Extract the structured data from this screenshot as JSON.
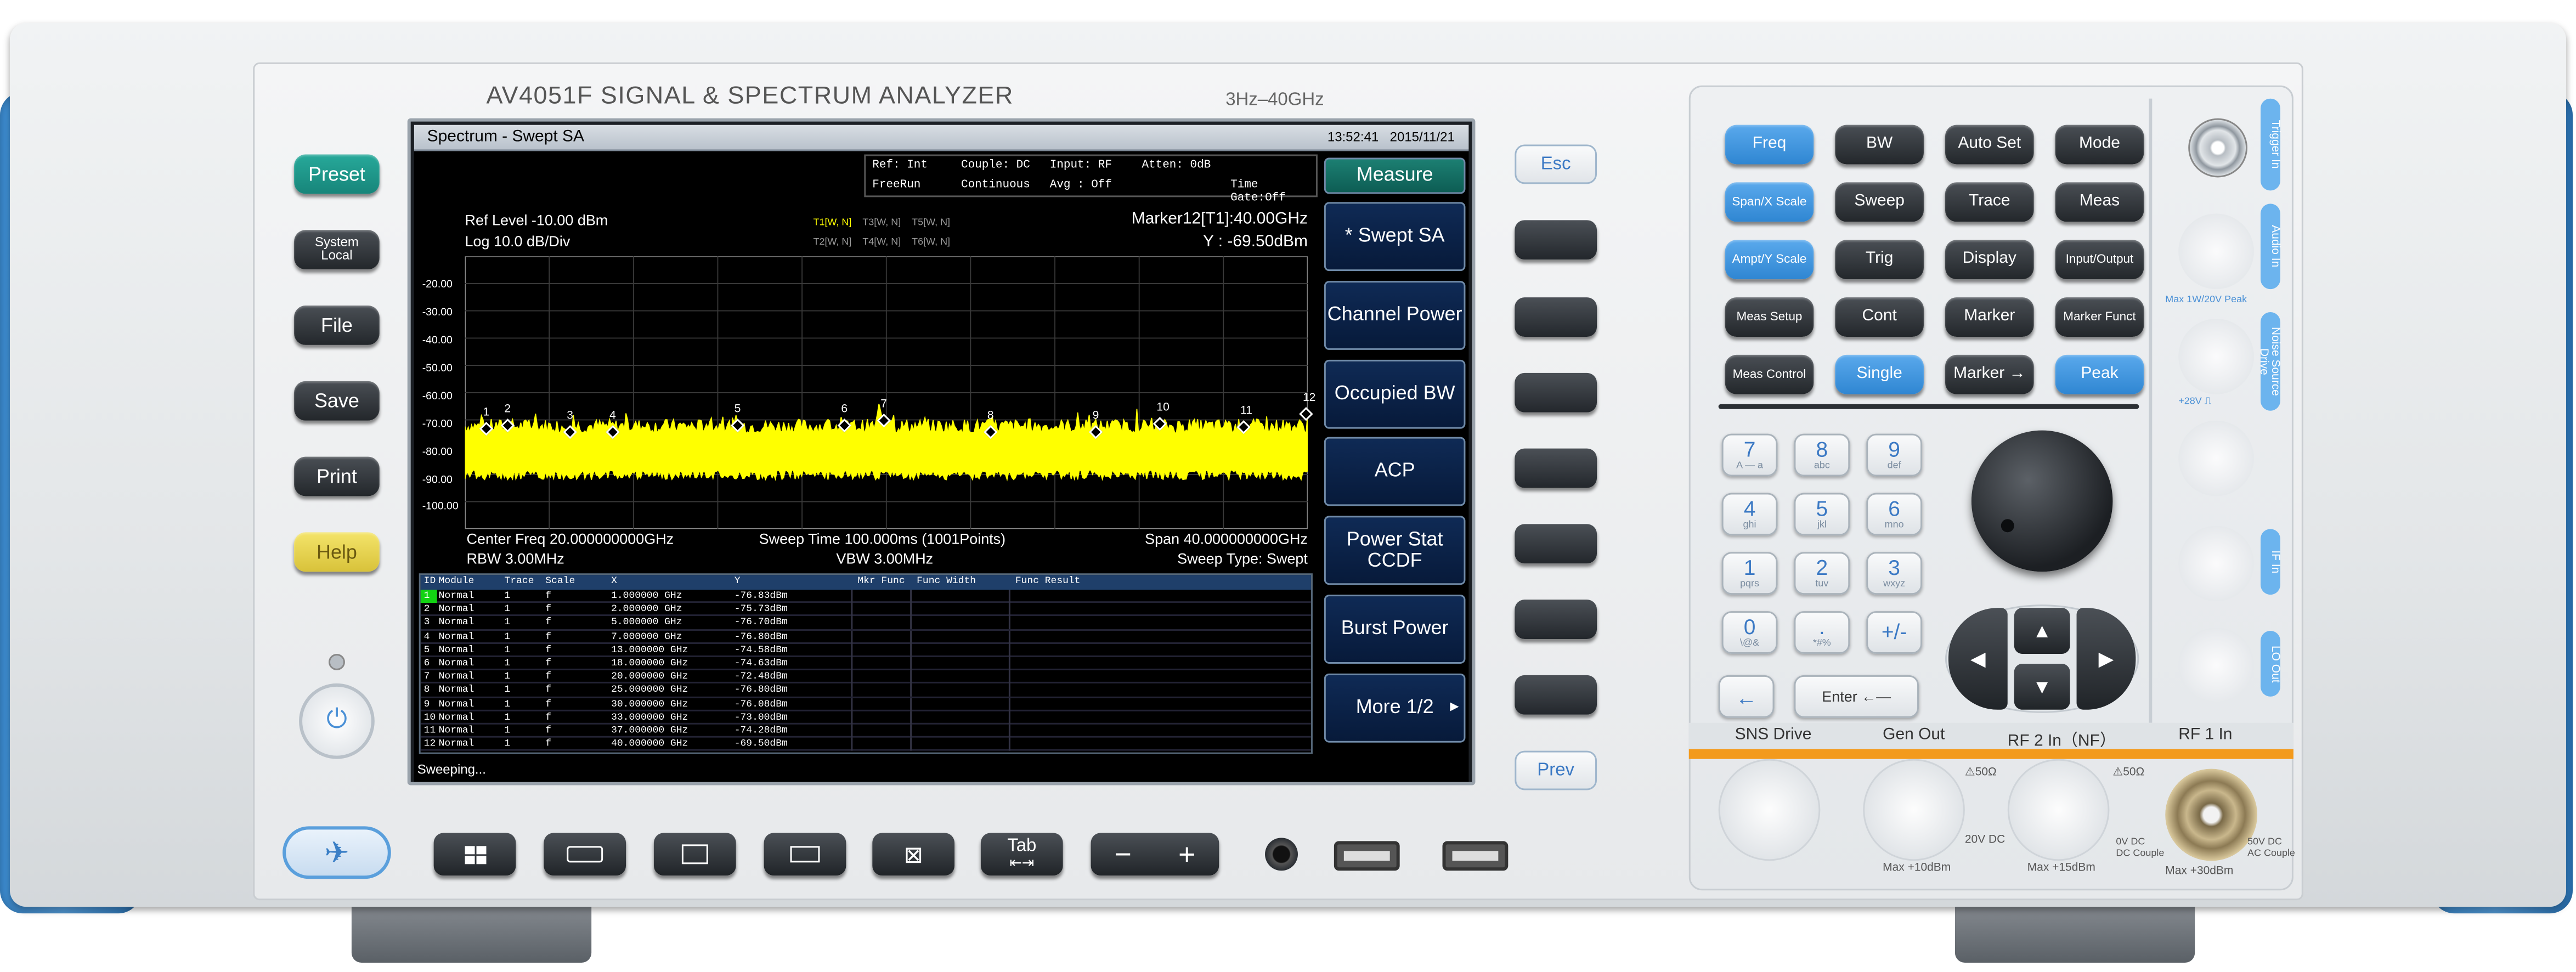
{
  "device": {
    "title": "AV4051F  SIGNAL & SPECTRUM ANALYZER",
    "freq_range": "3Hz–40GHz"
  },
  "left_keys": [
    "Preset",
    "System Local",
    "File",
    "Save",
    "Print",
    "Help"
  ],
  "screen": {
    "title": "Spectrum - Swept SA",
    "time": "13:52:41",
    "date": "2015/11/21",
    "status": {
      "ref": "Ref: Int",
      "couple": "Couple: DC",
      "input": "Input: RF",
      "atten": "Atten: 0dB",
      "trigger": "FreeRun",
      "sweep_mode": "Continuous",
      "avg": "Avg : Off",
      "time_gate": "Time Gate:Off"
    },
    "ref_level": "Ref Level -10.00 dBm",
    "scale": "Log 10.0 dB/Div",
    "trace_flags": {
      "t1": "T1[W, N]",
      "t3": "T3[W, N]",
      "t5": "T5[W, N]",
      "t2": "T2[W, N]",
      "t4": "T4[W, N]",
      "t6": "T6[W, N]"
    },
    "marker_readout": "Marker12[T1]:40.00GHz",
    "marker_y": "Y : -69.50dBm",
    "y_ticks": [
      "-20.00",
      "-30.00",
      "-40.00",
      "-50.00",
      "-60.00",
      "-70.00",
      "-80.00",
      "-90.00",
      "-100.00"
    ],
    "markers": [
      "1",
      "2",
      "3",
      "4",
      "5",
      "6",
      "7",
      "8",
      "9",
      "10",
      "11",
      "12"
    ],
    "center_freq": "Center Freq 20.000000000GHz",
    "sweep_time": "Sweep Time 100.000ms (1001Points)",
    "span": "Span 40.000000000GHz",
    "rbw": "RBW 3.00MHz",
    "vbw": "VBW 3.00MHz",
    "sweep_type": "Sweep Type: Swept",
    "table_headers": [
      "ID",
      "Module",
      "Trace",
      "Scale",
      "X",
      "Y",
      "Mkr Func",
      "Func Width",
      "Func Result"
    ],
    "table_rows": [
      [
        "1",
        "Normal",
        "1",
        "f",
        "1.000000 GHz",
        "-76.83dBm"
      ],
      [
        "2",
        "Normal",
        "1",
        "f",
        "2.000000 GHz",
        "-75.73dBm"
      ],
      [
        "3",
        "Normal",
        "1",
        "f",
        "5.000000 GHz",
        "-76.70dBm"
      ],
      [
        "4",
        "Normal",
        "1",
        "f",
        "7.000000 GHz",
        "-76.80dBm"
      ],
      [
        "5",
        "Normal",
        "1",
        "f",
        "13.000000 GHz",
        "-74.58dBm"
      ],
      [
        "6",
        "Normal",
        "1",
        "f",
        "18.000000 GHz",
        "-74.63dBm"
      ],
      [
        "7",
        "Normal",
        "1",
        "f",
        "20.000000 GHz",
        "-72.48dBm"
      ],
      [
        "8",
        "Normal",
        "1",
        "f",
        "25.000000 GHz",
        "-76.80dBm"
      ],
      [
        "9",
        "Normal",
        "1",
        "f",
        "30.000000 GHz",
        "-76.08dBm"
      ],
      [
        "10",
        "Normal",
        "1",
        "f",
        "33.000000 GHz",
        "-73.00dBm"
      ],
      [
        "11",
        "Normal",
        "1",
        "f",
        "37.000000 GHz",
        "-74.28dBm"
      ],
      [
        "12",
        "Normal",
        "1",
        "f",
        "40.000000 GHz",
        "-69.50dBm"
      ]
    ],
    "status_bar": "Sweeping..."
  },
  "softkeys": [
    "Measure",
    "* Swept SA",
    "Channel Power",
    "Occupied BW",
    "ACP",
    "Power Stat CCDF",
    "Burst Power",
    "More 1/2"
  ],
  "nav_keys": {
    "esc": "Esc",
    "prev": "Prev"
  },
  "function_keys": [
    [
      "Freq",
      "BW",
      "Auto Set",
      "Mode"
    ],
    [
      "Span/X Scale",
      "Sweep",
      "Trace",
      "Meas"
    ],
    [
      "Ampt/Y Scale",
      "Trig",
      "Display",
      "Input/Output"
    ],
    [
      "Meas Setup",
      "Cont",
      "Marker",
      "Marker Funct"
    ],
    [
      "Meas Control",
      "Single",
      "Marker →",
      "Peak"
    ]
  ],
  "numpad": [
    {
      "d": "7",
      "s": "A — a"
    },
    {
      "d": "8",
      "s": "abc"
    },
    {
      "d": "9",
      "s": "def"
    },
    {
      "d": "4",
      "s": "ghi"
    },
    {
      "d": "5",
      "s": "jkl"
    },
    {
      "d": "6",
      "s": "mno"
    },
    {
      "d": "1",
      "s": "pqrs"
    },
    {
      "d": "2",
      "s": "tuv"
    },
    {
      "d": "3",
      "s": "wxyz"
    },
    {
      "d": "0",
      "s": "\\@&"
    },
    {
      "d": ".",
      "s": "*#%"
    },
    {
      "d": "+/-",
      "s": ""
    }
  ],
  "enter_label": "Enter ←—",
  "backspace_label": "←",
  "bottom_keys": {
    "tab": "Tab"
  },
  "connectors": [
    "SNS Drive",
    "Gen Out",
    "RF 2 In（NF）",
    "RF 1 In"
  ],
  "connector_notes": {
    "gen_out": "Max +10dBm",
    "rf2": "Max +15dBm",
    "rf1": "Max +30dBm",
    "rf2_dc": "20V DC",
    "dc_couple": "0V DC\nDC Couple",
    "ac_couple": "50V DC\nAC Couple",
    "ohm1": "⚠50Ω",
    "ohm2": "⚠50Ω"
  },
  "side_ports": [
    "Trigger In",
    "Audio In",
    "Noise Source Drive",
    "IF In",
    "LO Out"
  ],
  "side_notes": {
    "max_peak": "Max 1W/20V Peak",
    "source_drive": "+28V ⎍"
  }
}
